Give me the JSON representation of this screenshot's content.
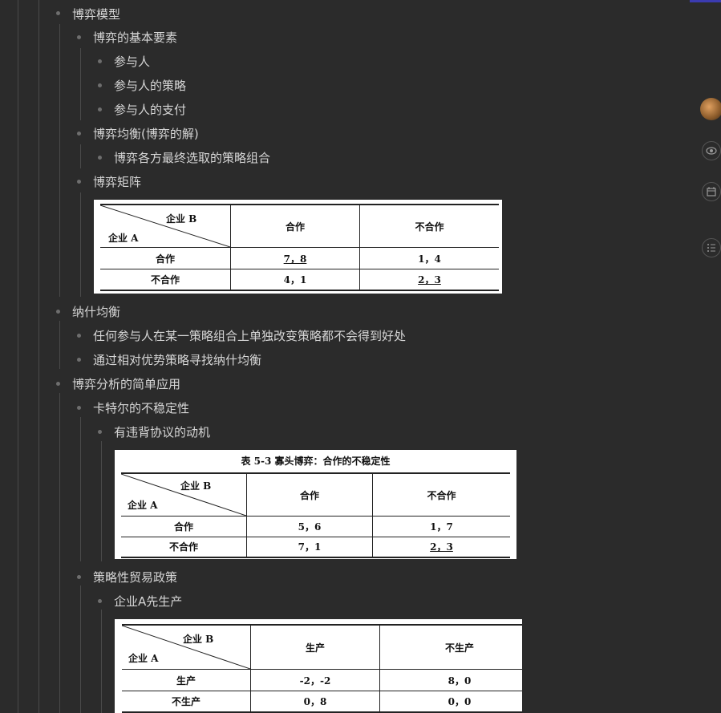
{
  "outline": {
    "l1_item_top": "博弈模型",
    "l2_basic": "博弈的基本要素",
    "l3_players": "参与人",
    "l3_strategy": "参与人的策略",
    "l3_payoff": "参与人的支付",
    "l2_equilibrium": "博弈均衡(博弈的解)",
    "l3_final": "博弈各方最终选取的策略组合",
    "l2_matrix": "博弈矩阵",
    "l1_nash": "纳什均衡",
    "l2_nash1": "任何参与人在某一策略组合上单独改变策略都不会得到好处",
    "l2_nash2": "通过相对优势策略寻找纳什均衡",
    "l1_apply": "博弈分析的简单应用",
    "l2_cartel": "卡特尔的不稳定性",
    "l3_motive": "有违背协议的动机",
    "l2_trade": "策略性贸易政策",
    "l3_firstA": "企业A先生产"
  },
  "table1": {
    "corner_top": "企业 B",
    "corner_bottom": "企业 A",
    "col1": "合作",
    "col2": "不合作",
    "r1_label": "合作",
    "r1_c1": "7，8",
    "r1_c2": "1，4",
    "r2_label": "不合作",
    "r2_c1": "4，1",
    "r2_c2": "2，3"
  },
  "table2": {
    "caption": "表 5-3   寡头博弈：合作的不稳定性",
    "corner_top": "企业 B",
    "corner_bottom": "企业 A",
    "col1": "合作",
    "col2": "不合作",
    "r1_label": "合作",
    "r1_c1": "5，6",
    "r1_c2": "1，7",
    "r2_label": "不合作",
    "r2_c1": "7，1",
    "r2_c2": "2，3"
  },
  "table3": {
    "corner_top": "企业 B",
    "corner_bottom": "企业 A",
    "col1": "生产",
    "col2": "不生产",
    "r1_label": "生产",
    "r1_c1": "-2，-2",
    "r1_c2": "8，0",
    "r2_label": "不生产",
    "r2_c1": "0，8",
    "r2_c2": "0，0"
  },
  "sidebar": {
    "icons": [
      "avatar",
      "eye-icon",
      "calendar-icon",
      "outline-icon"
    ]
  }
}
